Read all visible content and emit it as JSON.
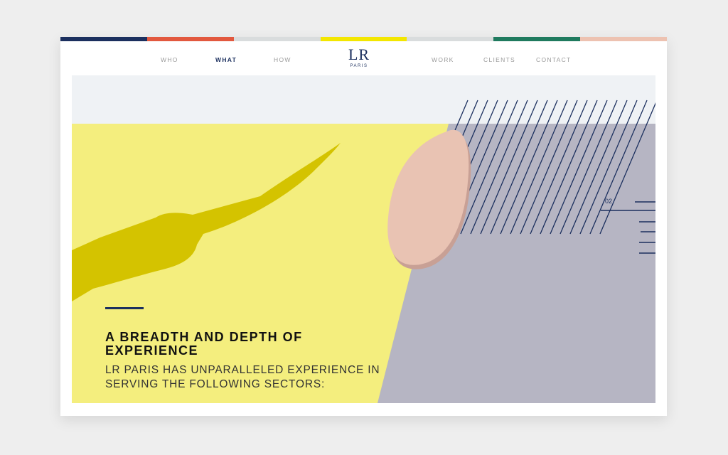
{
  "colors": {
    "stripes": [
      "#1b2f5e",
      "#e2583e",
      "#d9dcdd",
      "#f3e600",
      "#d9dcdd",
      "#1f7a5e",
      "#edc2b1"
    ],
    "navy": "#1b2f5e",
    "yellow": "#f4ee7e",
    "knife_shadow": "#d4c300",
    "gray": "#b6b5c3",
    "pink": "#e9c3b3",
    "sky": "#eff2f5"
  },
  "nav": {
    "items": [
      {
        "label": "WHO",
        "active": false
      },
      {
        "label": "WHAT",
        "active": true
      },
      {
        "label": "HOW",
        "active": false
      },
      {
        "label": "WORK",
        "active": false
      },
      {
        "label": "CLIENTS",
        "active": false
      },
      {
        "label": "CONTACT",
        "active": false
      }
    ]
  },
  "logo": {
    "main": "LR",
    "sub": "PARIS"
  },
  "hero": {
    "title": "A BREADTH AND DEPTH OF EXPERIENCE",
    "subtitle": "LR PARIS HAS UNPARALLELED EXPERIENCE IN SERVING THE FOLLOWING SECTORS:"
  },
  "slider": {
    "current": "02"
  }
}
